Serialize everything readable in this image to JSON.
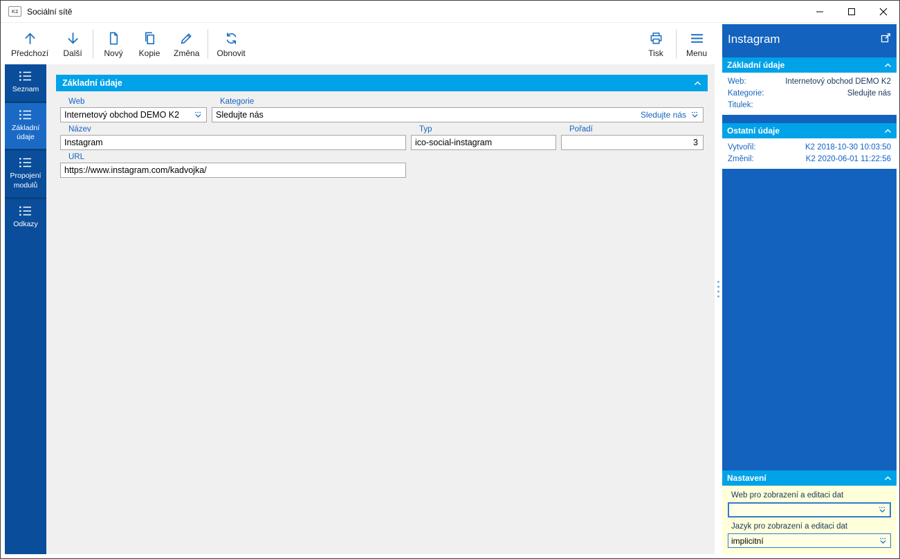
{
  "colors": {
    "accent_cyan": "#00a2e8",
    "sidebar_blue": "#0a4d9a",
    "sidebar_selected_blue": "#1a6ac5",
    "preview_panel_blue": "#1262be",
    "label_blue": "#1464c0",
    "value_navy": "#17365d",
    "value_blue": "#0f62c8",
    "toolbar_icon_blue": "#1b6ec2",
    "settings_yellow": "#ffffd9"
  },
  "window": {
    "title": "Sociální sítě",
    "app_badge": "K2"
  },
  "toolbar": {
    "buttons": [
      {
        "label": "Předchozí"
      },
      {
        "label": "Další"
      },
      {
        "label": "Nový"
      },
      {
        "label": "Kopie"
      },
      {
        "label": "Změna"
      },
      {
        "label": "Obnovit"
      },
      {
        "label": "Tisk"
      },
      {
        "label": "Menu"
      }
    ]
  },
  "sidebar": {
    "items": [
      {
        "label": "Seznam"
      },
      {
        "label": "Základní údaje"
      },
      {
        "label": "Propojení modulů"
      },
      {
        "label": "Odkazy"
      }
    ]
  },
  "form": {
    "section_title": "Základní údaje",
    "web_label": "Web",
    "web_value": "Internetový obchod DEMO K2",
    "kategorie_label": "Kategorie",
    "kategorie_value": "Sledujte nás",
    "kategorie_lookup": "Sledujte nás",
    "nazev_label": "Název",
    "nazev_value": "Instagram",
    "typ_label": "Typ",
    "typ_value": "ico-social-instagram",
    "poradi_label": "Pořadí",
    "poradi_value": "3",
    "url_label": "URL",
    "url_value": "https://www.instagram.com/kadvojka/"
  },
  "preview": {
    "title": "Instagram",
    "basic": {
      "title": "Základní údaje",
      "rows": [
        {
          "label": "Web:",
          "value": "Internetový obchod DEMO K2"
        },
        {
          "label": "Kategorie:",
          "value": "Sledujte nás"
        },
        {
          "label": "Titulek:",
          "value": ""
        }
      ]
    },
    "other": {
      "title": "Ostatní údaje",
      "rows": [
        {
          "label": "Vytvořil:",
          "value": "K2 2018-10-30 10:03:50"
        },
        {
          "label": "Změnil:",
          "value": "K2 2020-06-01 11:22:56"
        }
      ]
    },
    "settings": {
      "title": "Nastavení",
      "web_label": "Web pro zobrazení a editaci dat",
      "web_value": "",
      "lang_label": "Jazyk pro zobrazení a editaci dat",
      "lang_value": "implicitní"
    }
  }
}
